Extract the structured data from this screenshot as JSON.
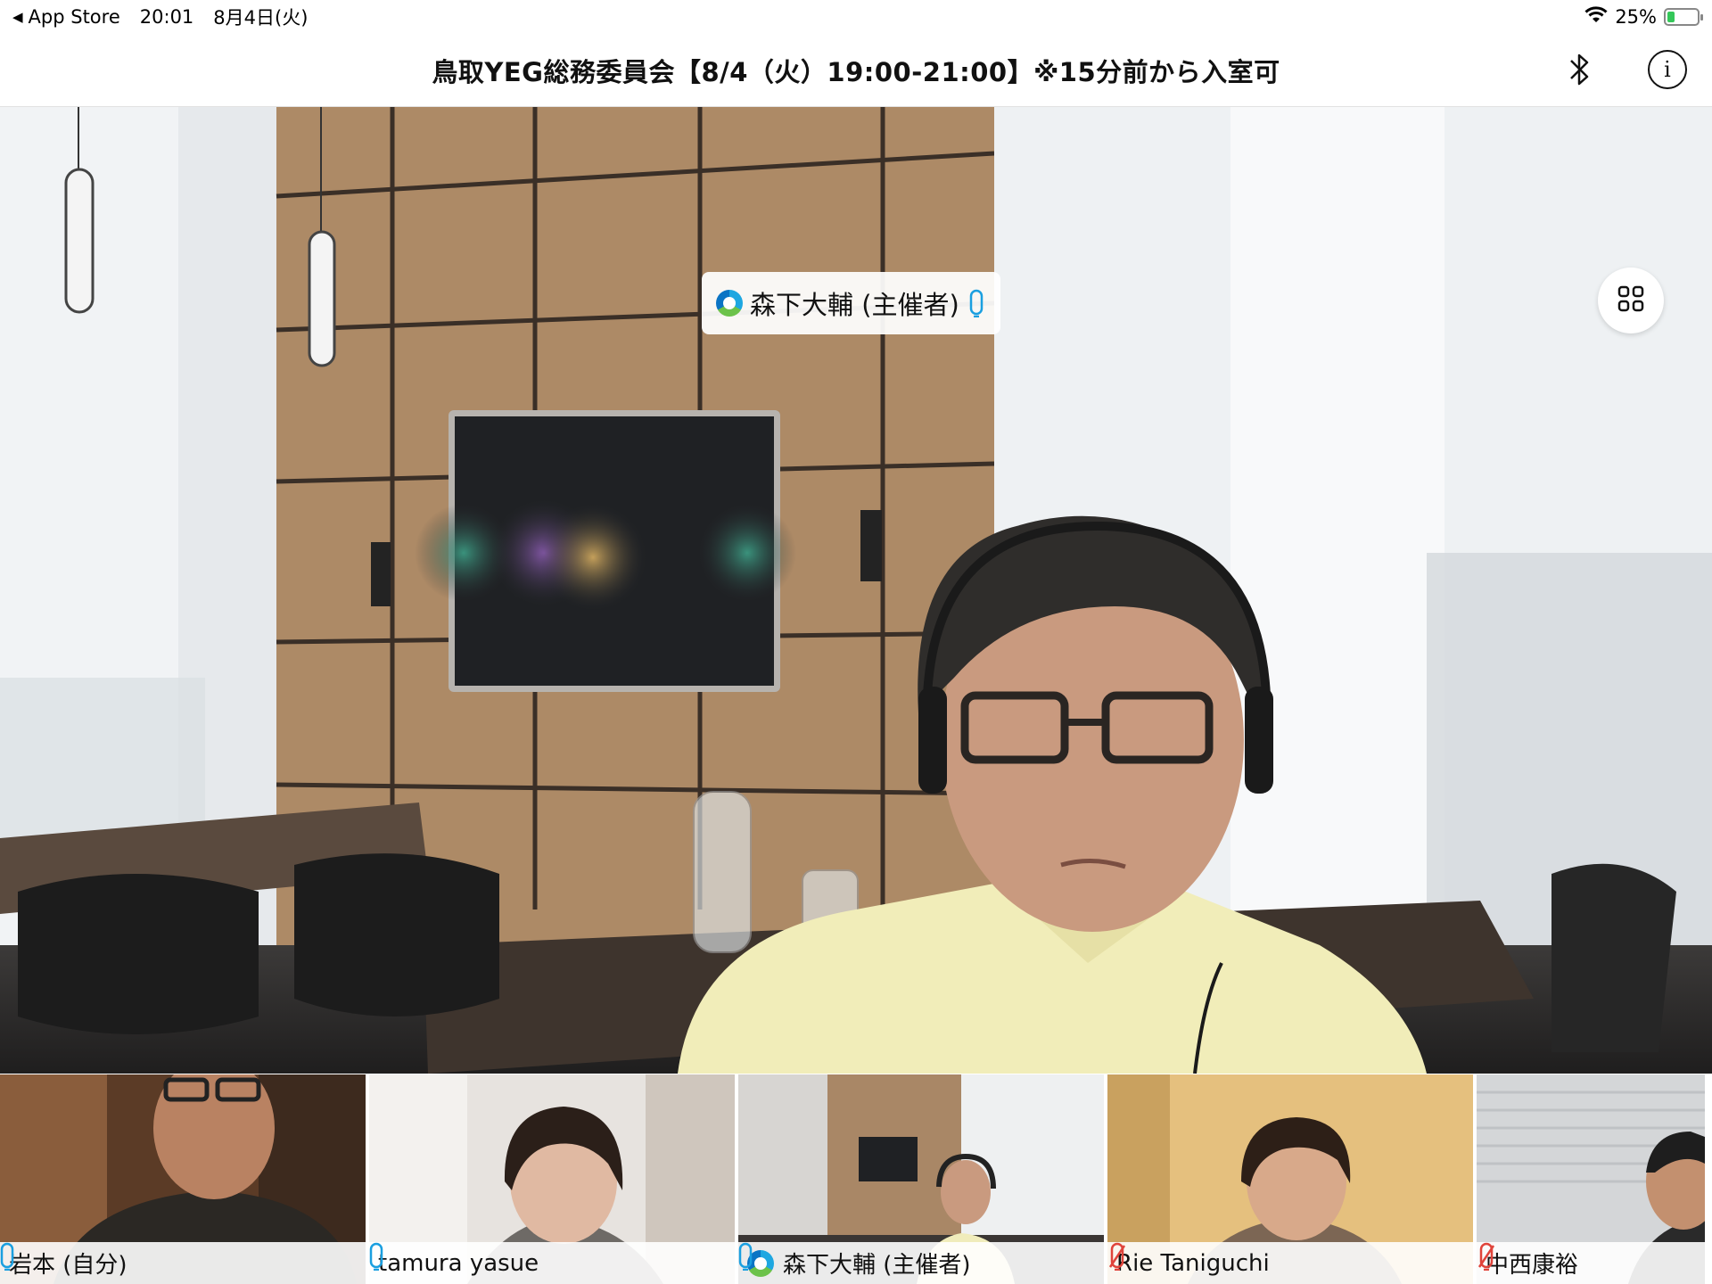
{
  "status_bar": {
    "back_app": "App Store",
    "time": "20:01",
    "date": "8月4日(火)",
    "battery": "25%",
    "battery_level": 0.25
  },
  "meeting": {
    "title": "鳥取YEG総務委員会【8/4（火）19:00-21:00】※15分前から入室可"
  },
  "main_video": {
    "speaker_name": "森下大輔 (主催者)",
    "mic_state": "unmuted"
  },
  "colors": {
    "mic_active": "#1a9fe0",
    "mic_muted": "#e0443b",
    "battery_green": "#34c759"
  },
  "participants": [
    {
      "name": "岩本 (自分)",
      "mic": "unmuted",
      "host": false
    },
    {
      "name": "tamura yasue",
      "mic": "unmuted",
      "host": false
    },
    {
      "name": "森下大輔 (主催者)",
      "mic": "unmuted",
      "host": true
    },
    {
      "name": "Rie Taniguchi",
      "mic": "muted",
      "host": false
    },
    {
      "name": "中西康裕",
      "mic": "muted",
      "host": false
    }
  ]
}
